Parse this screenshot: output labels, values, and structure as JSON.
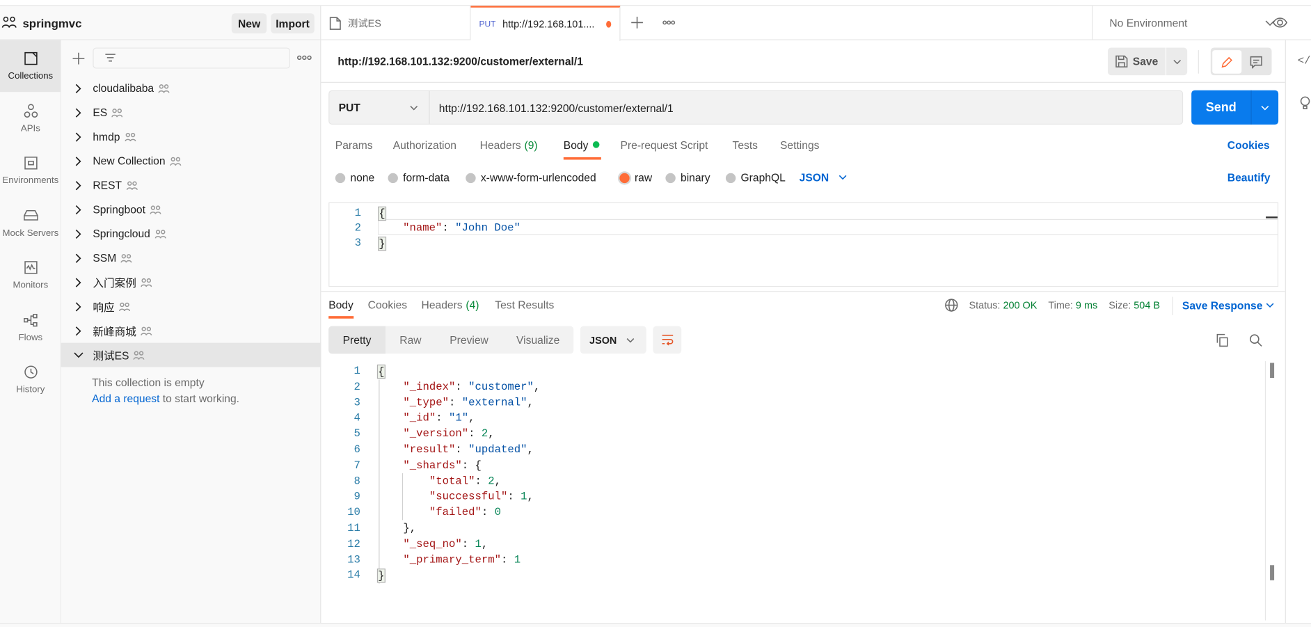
{
  "workspace": {
    "name": "springmvc",
    "new_label": "New",
    "import_label": "Import"
  },
  "nav": [
    {
      "label": "Collections",
      "icon": "collections-icon",
      "active": true
    },
    {
      "label": "APIs",
      "icon": "apis-icon"
    },
    {
      "label": "Environments",
      "icon": "environments-icon"
    },
    {
      "label": "Mock Servers",
      "icon": "mock-servers-icon"
    },
    {
      "label": "Monitors",
      "icon": "monitors-icon"
    },
    {
      "label": "Flows",
      "icon": "flows-icon"
    },
    {
      "label": "History",
      "icon": "history-icon"
    }
  ],
  "collections": {
    "items": [
      "cloudalibaba",
      "ES",
      "hmdp",
      "New Collection",
      "REST",
      "Springboot",
      "Springcloud",
      "SSM",
      "入门案例",
      "响应",
      "新峰商城",
      "测试ES"
    ],
    "expanded": "测试ES",
    "empty_text": "This collection is empty",
    "add_request_link": "Add a request",
    "add_request_suffix": " to start working."
  },
  "tabs": [
    {
      "label": "测试ES",
      "type": "collection"
    },
    {
      "method": "PUT",
      "label": "http://192.168.101....",
      "active": true,
      "unsaved": true
    }
  ],
  "environment": {
    "selected": "No Environment"
  },
  "request": {
    "title": "http://192.168.101.132:9200/customer/external/1",
    "save_label": "Save",
    "method": "PUT",
    "url": "http://192.168.101.132:9200/customer/external/1",
    "send_label": "Send",
    "tabs": [
      {
        "label": "Params"
      },
      {
        "label": "Authorization"
      },
      {
        "label": "Headers",
        "count": "(9)"
      },
      {
        "label": "Body",
        "active": true
      },
      {
        "label": "Pre-request Script"
      },
      {
        "label": "Tests"
      },
      {
        "label": "Settings"
      }
    ],
    "cookies_label": "Cookies",
    "body_modes": [
      "none",
      "form-data",
      "x-www-form-urlencoded",
      "raw",
      "binary",
      "GraphQL"
    ],
    "body_mode_selected": "raw",
    "body_language": "JSON",
    "beautify_label": "Beautify",
    "body_lines": [
      "{",
      "\"name\": \"John Doe\"",
      "}"
    ]
  },
  "response": {
    "tabs": [
      {
        "label": "Body",
        "active": true
      },
      {
        "label": "Cookies"
      },
      {
        "label": "Headers",
        "count": "(4)"
      },
      {
        "label": "Test Results"
      }
    ],
    "status_label": "Status:",
    "status": "200 OK",
    "time_label": "Time:",
    "time": "9 ms",
    "size_label": "Size:",
    "size": "504 B",
    "save_response_label": "Save Response",
    "view_modes": [
      "Pretty",
      "Raw",
      "Preview",
      "Visualize"
    ],
    "view_selected": "Pretty",
    "format": "JSON",
    "body_lines": [
      "{",
      "    \"_index\": \"customer\",",
      "    \"_type\": \"external\",",
      "    \"_id\": \"1\",",
      "    \"_version\": 2,",
      "    \"result\": \"updated\",",
      "    \"_shards\": {",
      "        \"total\": 2,",
      "        \"successful\": 1,",
      "        \"failed\": 0",
      "    },",
      "    \"_seq_no\": 1,",
      "    \"_primary_term\": 1",
      "}"
    ]
  },
  "colors": {
    "accent": "#ff6c37",
    "send": "#097bed",
    "link": "#0265d2",
    "success": "#0cbb52",
    "status_green": "#007f31"
  }
}
